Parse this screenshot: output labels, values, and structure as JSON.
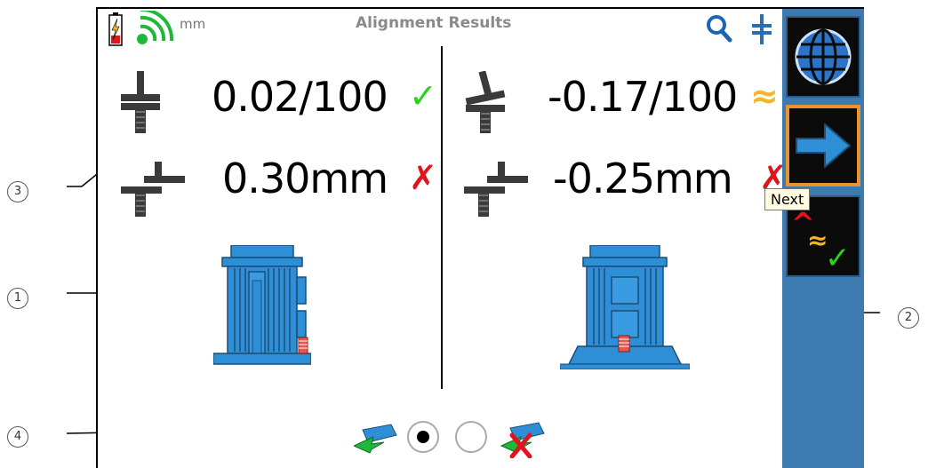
{
  "header": {
    "title": "Alignment Results",
    "units": "mm"
  },
  "results": {
    "angularity_left": "0.02/100",
    "offset_left": "0.30mm",
    "angularity_right": "-0.17/100",
    "offset_right": "-0.25mm"
  },
  "status_glyphs": {
    "ok": "✓",
    "warn": "≈",
    "bad": "✗"
  },
  "statuses": {
    "angularity_left": "ok",
    "offset_left": "bad",
    "angularity_right": "warn",
    "offset_right": "bad"
  },
  "sidebar": {
    "buttons": [
      {
        "name": "globe-icon",
        "active": false
      },
      {
        "name": "next-arrow-icon",
        "active": true
      },
      {
        "name": "tolerance-icon",
        "active": false
      }
    ],
    "tooltip": "Next"
  },
  "selector": {
    "selected_index": 0
  },
  "callouts": [
    "3",
    "1",
    "4",
    "2"
  ],
  "colors": {
    "sidebar_bg": "#3d7ab0",
    "accent_orange": "#e8932d",
    "ok_green": "#2fd11f",
    "warn_amber": "#f3b52a",
    "bad_red": "#e0141c",
    "motor_blue": "#2f8fd6"
  }
}
